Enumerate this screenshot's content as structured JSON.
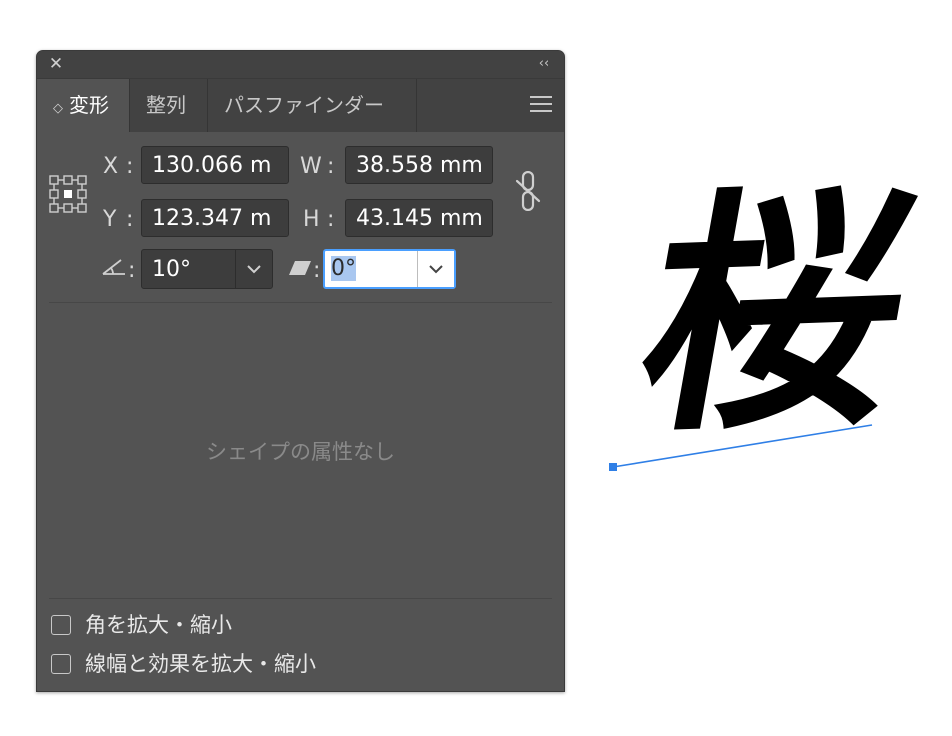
{
  "panel": {
    "close_glyph": "✕",
    "collapse_glyph": "‹‹",
    "tabs": [
      {
        "label": "変形",
        "icon": "diamond-updown-icon",
        "active": true
      },
      {
        "label": "整列",
        "active": false
      },
      {
        "label": "パスファインダー",
        "active": false
      }
    ],
    "transform": {
      "x_label": "X",
      "x_value": "130.066 m",
      "y_label": "Y",
      "y_value": "123.347 m",
      "w_label": "W",
      "w_value": "38.558 mm",
      "h_label": "H",
      "h_value": "43.145 mm",
      "colon": ":",
      "rotate_value": "10°",
      "shear_value": "0°"
    },
    "no_shape_text": "シェイプの属性なし",
    "scale_corners_label": "角を拡大・縮小",
    "scale_strokes_label": "線幅と効果を拡大・縮小"
  },
  "artwork": {
    "character": "桜",
    "path_color": "#2f7fe6"
  },
  "colors": {
    "panel_bg": "#535353",
    "tab_bar_bg": "#424242",
    "focus": "#4a9fff"
  }
}
